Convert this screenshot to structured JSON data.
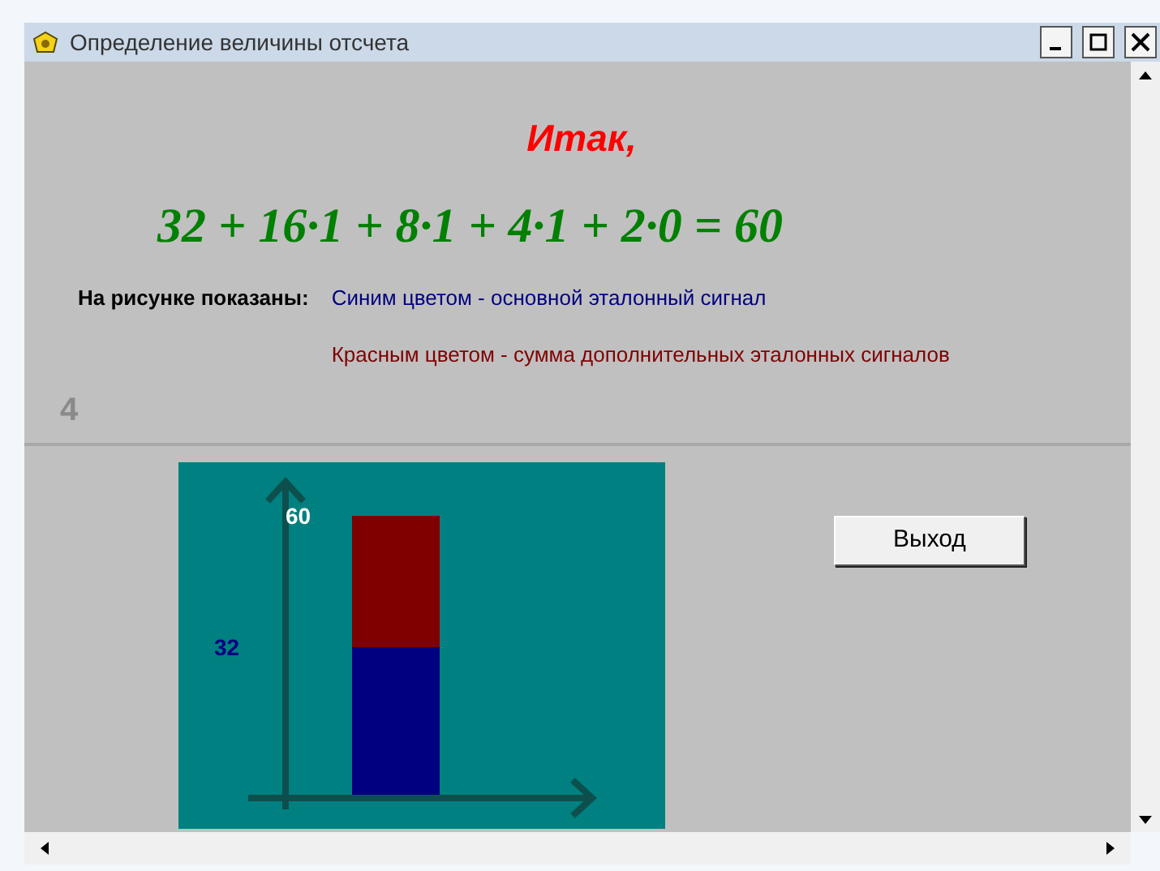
{
  "window": {
    "title": "Определение величины отсчета"
  },
  "heading": "Итак,",
  "equation": "32 + 16·1 + 8·1 + 4·1 + 2·0 = 60",
  "legend": {
    "label": "На рисунке показаны:",
    "items": [
      {
        "text": "Синим цветом - основной эталонный сигнал",
        "color": "#000080"
      },
      {
        "text": "Красным цветом - сумма дополнительных эталонных сигналов",
        "color": "#800000"
      }
    ]
  },
  "page_number": "4",
  "chart": {
    "segments": [
      {
        "color": "#000080",
        "label": "32"
      },
      {
        "color": "#800000",
        "label": "60"
      }
    ]
  },
  "exit_button": "Выход"
}
